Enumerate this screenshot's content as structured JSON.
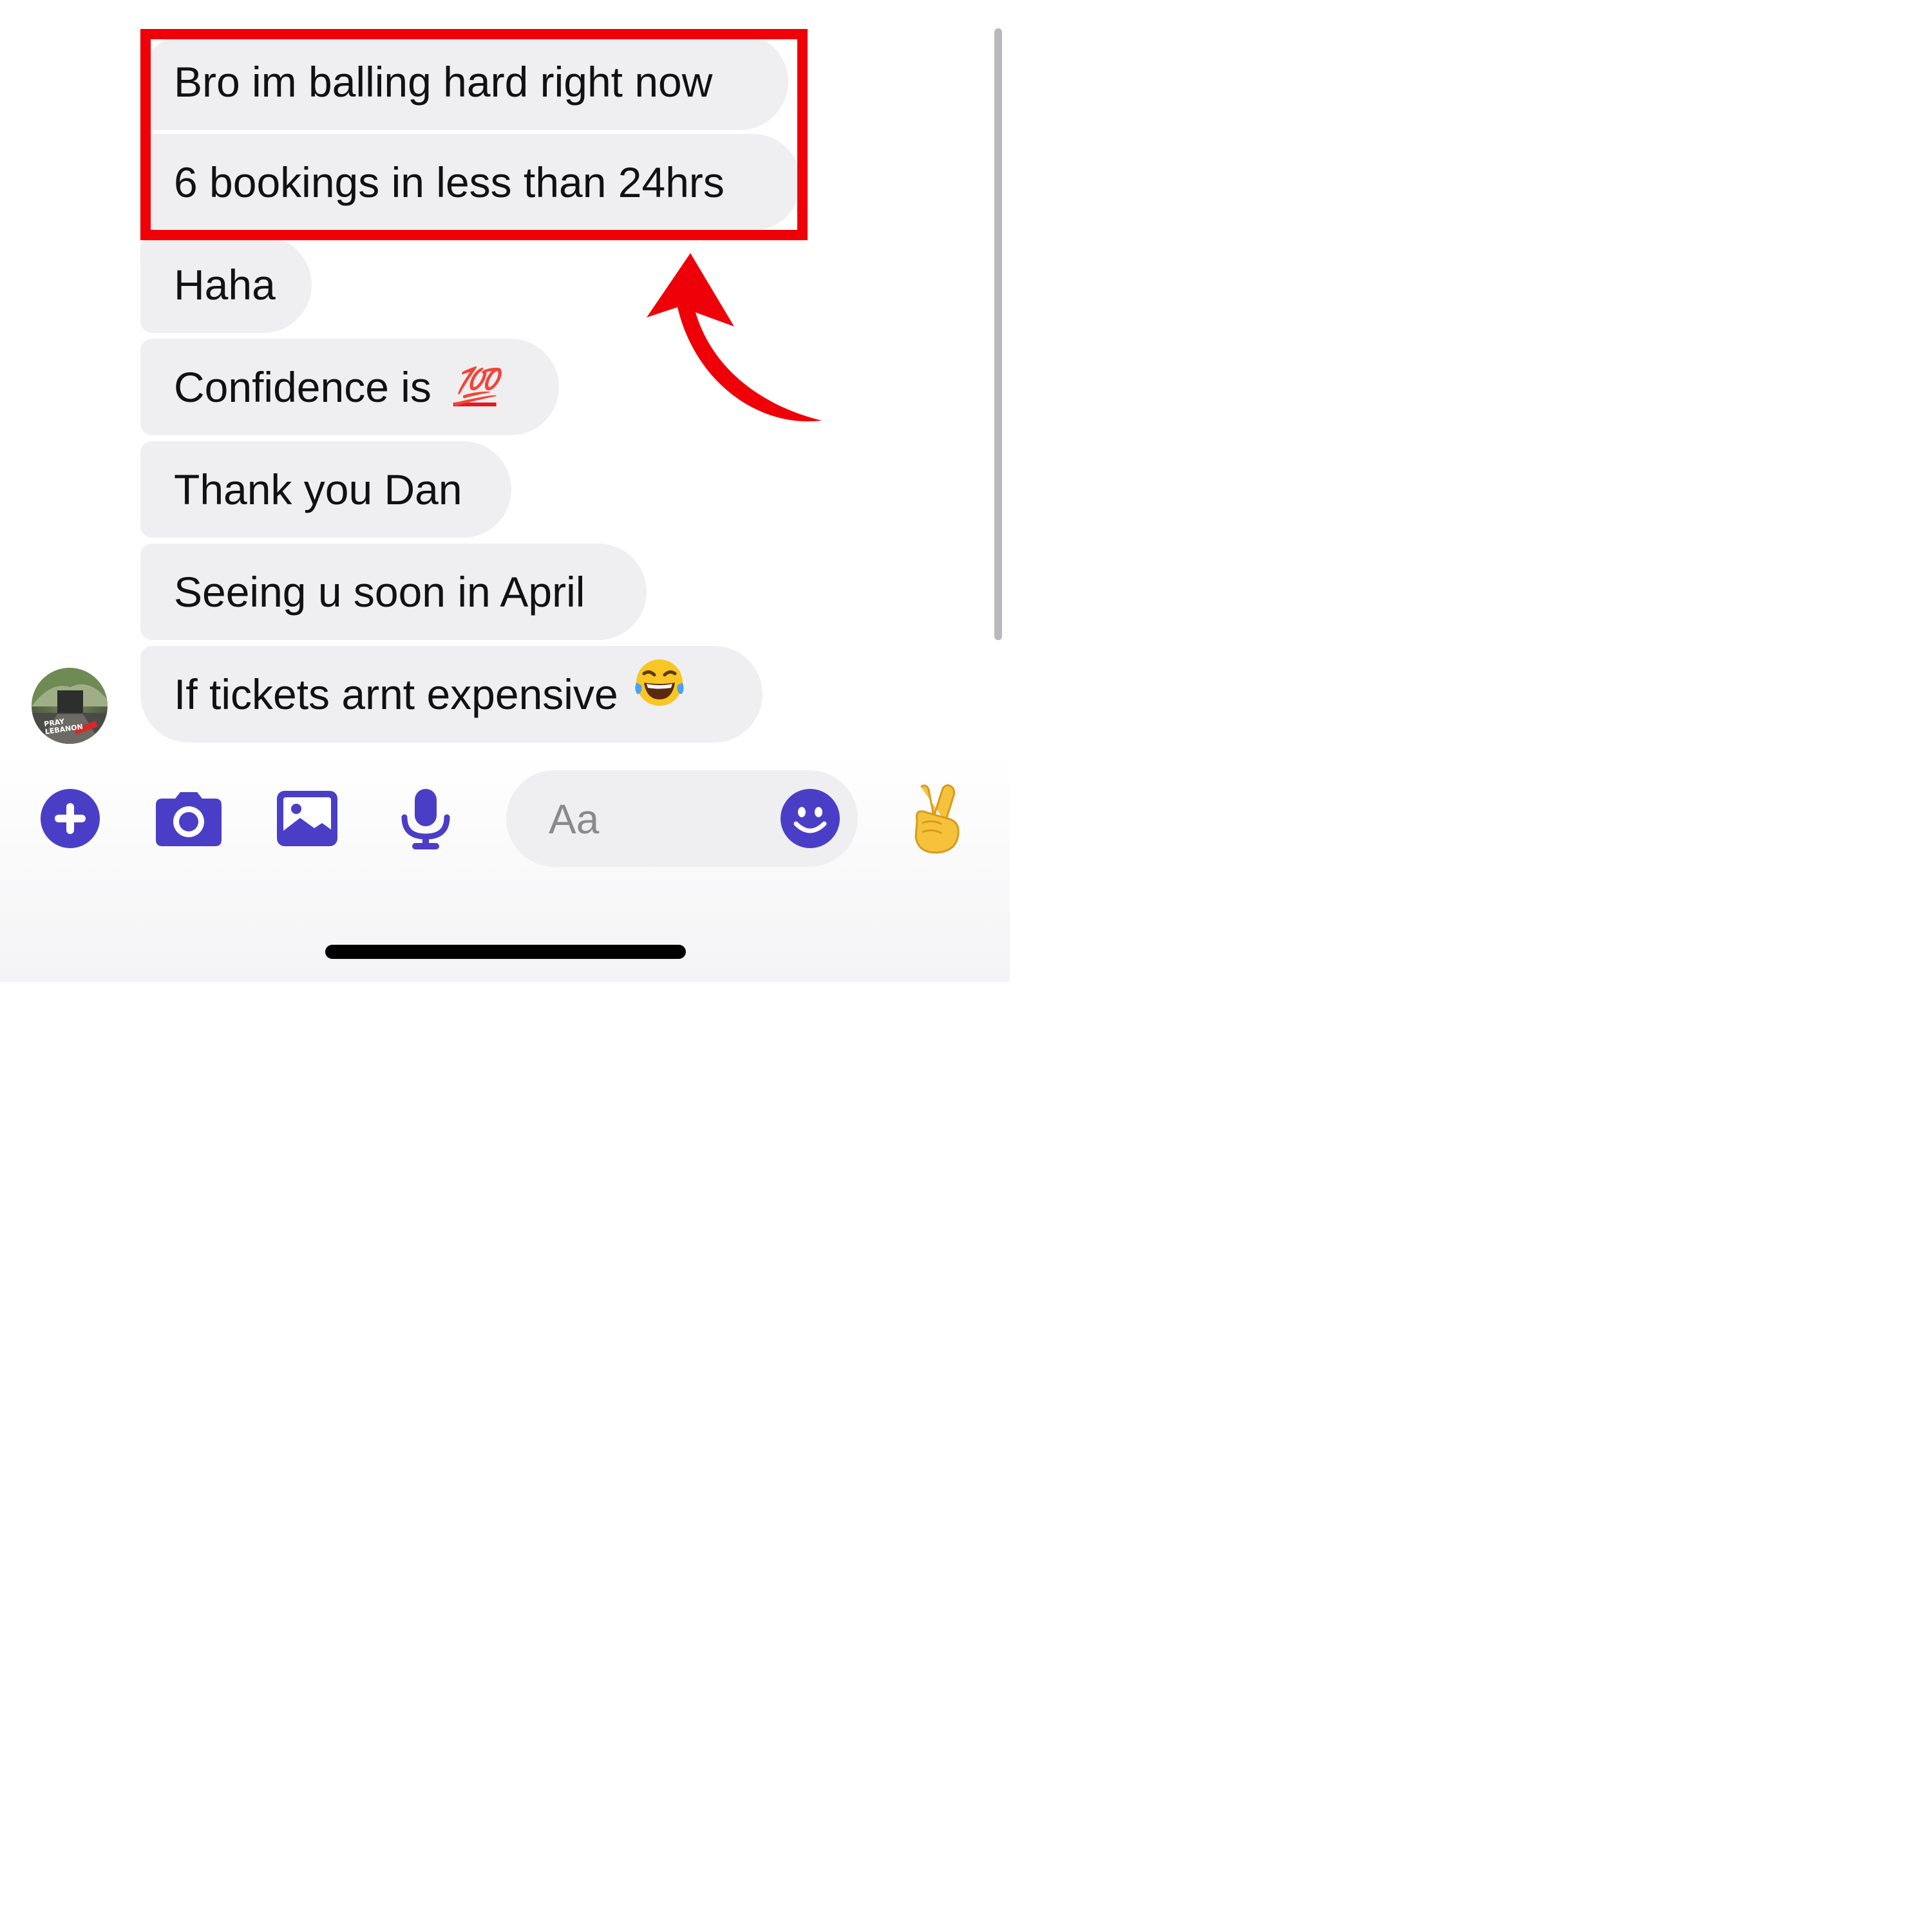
{
  "messages": [
    {
      "text": "Bro im balling hard right now",
      "emoji": ""
    },
    {
      "text": "6 bookings in less than 24hrs",
      "emoji": ""
    },
    {
      "text": "Haha",
      "emoji": ""
    },
    {
      "text": "Confidence is",
      "emoji": "💯"
    },
    {
      "text": "Thank you Dan",
      "emoji": ""
    },
    {
      "text": "Seeing u soon in April",
      "emoji": ""
    },
    {
      "text": "If tickets arnt expensive",
      "emoji": "😂"
    }
  ],
  "avatar": {
    "text_line1": "PRAY",
    "text_line2": "LEBANON"
  },
  "composer": {
    "placeholder": "Aa",
    "icons": [
      "plus-icon",
      "camera-icon",
      "image-icon",
      "microphone-icon",
      "emoji-icon",
      "victory-hand-icon"
    ],
    "quick_reaction": "✌"
  },
  "colors": {
    "accent": "#4b3ec6",
    "bubble": "#efeff1",
    "highlight": "#ef0008",
    "hundred": "#e01a22",
    "victory_hand": "#f7c23b"
  }
}
